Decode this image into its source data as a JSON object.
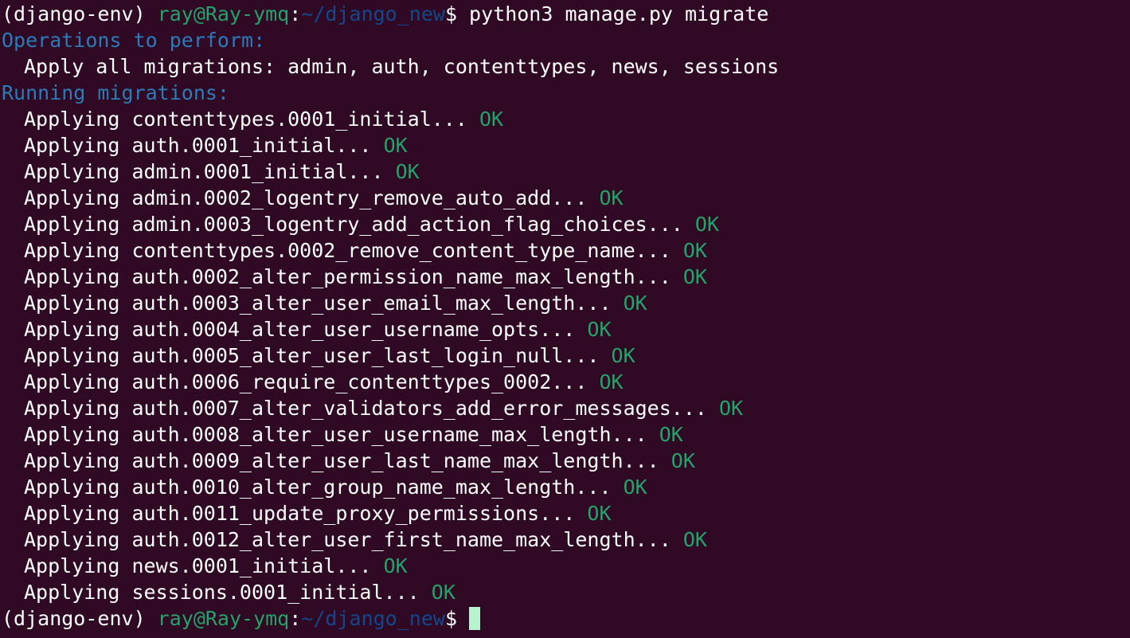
{
  "colors": {
    "background": "#300a24",
    "text": "#ffffff",
    "user_host": "#26a269",
    "path": "#12488b",
    "heading": "#2a7bb8",
    "ok": "#26a269",
    "cursor": "#b8f3cf"
  },
  "prompt": {
    "env": "(django-env) ",
    "user_host": "ray@Ray-ymq",
    "colon": ":",
    "path": "~/django_new",
    "dollar": "$ "
  },
  "command": "python3 manage.py migrate",
  "operations_heading": "Operations to perform:",
  "apply_all": "Apply all migrations: admin, auth, contenttypes, news, sessions",
  "running_heading": "Running migrations:",
  "migrations": [
    {
      "text": "Applying contenttypes.0001_initial...",
      "status": "OK"
    },
    {
      "text": "Applying auth.0001_initial...",
      "status": "OK"
    },
    {
      "text": "Applying admin.0001_initial...",
      "status": "OK"
    },
    {
      "text": "Applying admin.0002_logentry_remove_auto_add...",
      "status": "OK"
    },
    {
      "text": "Applying admin.0003_logentry_add_action_flag_choices...",
      "status": "OK"
    },
    {
      "text": "Applying contenttypes.0002_remove_content_type_name...",
      "status": "OK"
    },
    {
      "text": "Applying auth.0002_alter_permission_name_max_length...",
      "status": "OK"
    },
    {
      "text": "Applying auth.0003_alter_user_email_max_length...",
      "status": "OK"
    },
    {
      "text": "Applying auth.0004_alter_user_username_opts...",
      "status": "OK"
    },
    {
      "text": "Applying auth.0005_alter_user_last_login_null...",
      "status": "OK"
    },
    {
      "text": "Applying auth.0006_require_contenttypes_0002...",
      "status": "OK"
    },
    {
      "text": "Applying auth.0007_alter_validators_add_error_messages...",
      "status": "OK"
    },
    {
      "text": "Applying auth.0008_alter_user_username_max_length...",
      "status": "OK"
    },
    {
      "text": "Applying auth.0009_alter_user_last_name_max_length...",
      "status": "OK"
    },
    {
      "text": "Applying auth.0010_alter_group_name_max_length...",
      "status": "OK"
    },
    {
      "text": "Applying auth.0011_update_proxy_permissions...",
      "status": "OK"
    },
    {
      "text": "Applying auth.0012_alter_user_first_name_max_length...",
      "status": "OK"
    },
    {
      "text": "Applying news.0001_initial...",
      "status": "OK"
    },
    {
      "text": "Applying sessions.0001_initial...",
      "status": "OK"
    }
  ]
}
